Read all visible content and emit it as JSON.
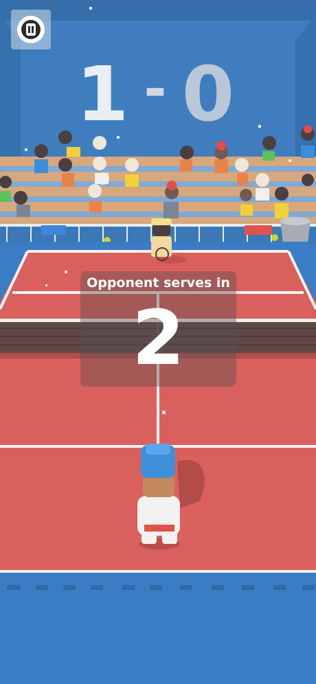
{
  "scoreboard": {
    "player_score": "1",
    "separator": "-",
    "opponent_score": "0"
  },
  "countdown": {
    "label": "Opponent serves in",
    "seconds": "2"
  },
  "pause_button": {
    "icon": "pause-icon"
  },
  "colors": {
    "court_red": "#d9605c",
    "court_lines": "#f3f1ee",
    "stadium_blue": "#3a78b8",
    "overlay": "rgba(90,80,80,0.42)"
  }
}
